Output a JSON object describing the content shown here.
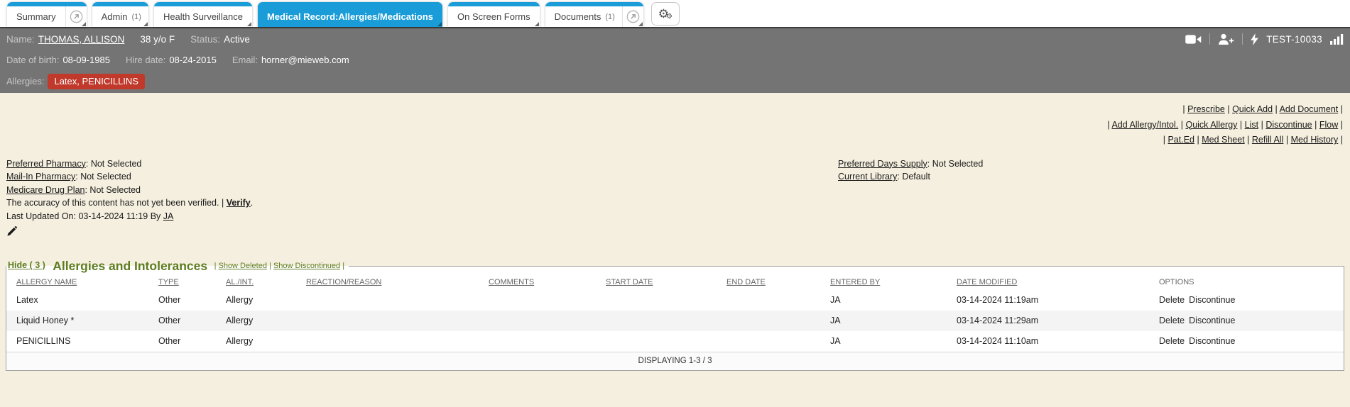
{
  "tabbar": {
    "tabs": [
      {
        "label": "Summary"
      },
      {
        "label": "Admin",
        "count": "(1)"
      },
      {
        "label": "Health Surveillance"
      },
      {
        "label": "Medical Record:Allergies/Medications"
      },
      {
        "label": "On Screen Forms"
      },
      {
        "label": "Documents",
        "count": "(1)"
      }
    ]
  },
  "patient": {
    "name_label": "Name:",
    "name": "THOMAS, ALLISON",
    "age_sex": "38 y/o F",
    "status_label": "Status:",
    "status": "Active",
    "chart_id": "TEST-10033",
    "dob_label": "Date of birth:",
    "dob": "08-09-1985",
    "hire_label": "Hire date:",
    "hire": "08-24-2015",
    "email_label": "Email:",
    "email": "horner@mieweb.com",
    "allergies_label": "Allergies:",
    "allergies_badge": "Latex, PENICILLINS"
  },
  "quicklinks": {
    "row1": [
      "Prescribe",
      "Quick Add",
      "Add Document"
    ],
    "row2": [
      "Add Allergy/Intol.",
      "Quick Allergy",
      "List",
      "Discontinue",
      "Flow"
    ],
    "row3": [
      "Pat.Ed",
      "Med Sheet",
      "Refill All",
      "Med History"
    ],
    "separator": "|"
  },
  "pharmacy": {
    "preferred_label": "Preferred Pharmacy",
    "preferred_value": "Not Selected",
    "mailin_label": "Mail-In Pharmacy",
    "mailin_value": "Not Selected",
    "medicare_label": "Medicare Drug Plan",
    "medicare_value": "Not Selected",
    "accuracy_text": "The accuracy of this content has not yet been verified.",
    "verify_label": "Verify",
    "verify_suffix": ".",
    "last_updated_text": "Last Updated On: 03-14-2024 11:19 By",
    "last_updated_by": "JA",
    "days_supply_label": "Preferred Days Supply",
    "days_supply_value": "Not Selected",
    "library_label": "Current Library",
    "library_value": "Default"
  },
  "allergy_section": {
    "hide_label": "Hide ( 3 )",
    "title": "Allergies and Intolerances",
    "show_deleted": "Show Deleted",
    "show_discontinued": "Show Discontinued",
    "columns": [
      "ALLERGY NAME",
      "TYPE",
      "AL./INT.",
      "REACTION/REASON",
      "COMMENTS",
      "START DATE",
      "END DATE",
      "ENTERED BY",
      "DATE MODIFIED",
      "OPTIONS"
    ],
    "rows": [
      {
        "name": "Latex",
        "type": "Other",
        "al_int": "Allergy",
        "reaction": "",
        "comments": "",
        "start": "",
        "end": "",
        "entered_by": "JA",
        "modified": "03-14-2024 11:19am",
        "opt1": "Delete",
        "opt2": "Discontinue"
      },
      {
        "name": "Liquid Honey *",
        "type": "Other",
        "al_int": "Allergy",
        "reaction": "",
        "comments": "",
        "start": "",
        "end": "",
        "entered_by": "JA",
        "modified": "03-14-2024 11:29am",
        "opt1": "Delete",
        "opt2": "Discontinue"
      },
      {
        "name": "PENICILLINS",
        "type": "Other",
        "al_int": "Allergy",
        "reaction": "",
        "comments": "",
        "start": "",
        "end": "",
        "entered_by": "JA",
        "modified": "03-14-2024 11:10am",
        "opt1": "Delete",
        "opt2": "Discontinue"
      }
    ],
    "footer": "DISPLAYING 1-3 / 3"
  },
  "colors": {
    "accent_blue": "#1a9cd8",
    "band_gray": "#747474",
    "beige": "#f5efdf",
    "badge_red": "#c0392b",
    "section_green": "#5e7d20"
  }
}
